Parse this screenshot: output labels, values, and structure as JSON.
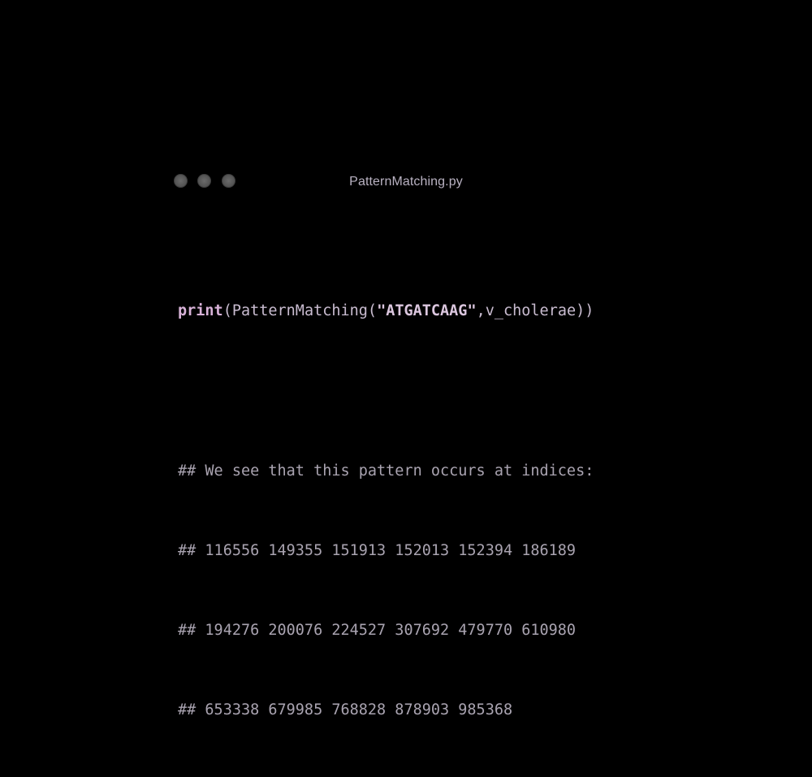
{
  "window": {
    "title": "PatternMatching.py"
  },
  "code": {
    "line1": {
      "keyword": "print",
      "open": "(",
      "function": "PatternMatching",
      "open2": "(",
      "string": "\"ATGATCAAG\"",
      "comma": ",",
      "variable": "v_cholerae",
      "close": "))"
    },
    "comments": [
      "## We see that this pattern occurs at indices:",
      "## 116556 149355 151913 152013 152394 186189",
      "## 194276 200076 224527 307692 479770 610980",
      "## 653338 679985 768828 878903 985368"
    ]
  }
}
